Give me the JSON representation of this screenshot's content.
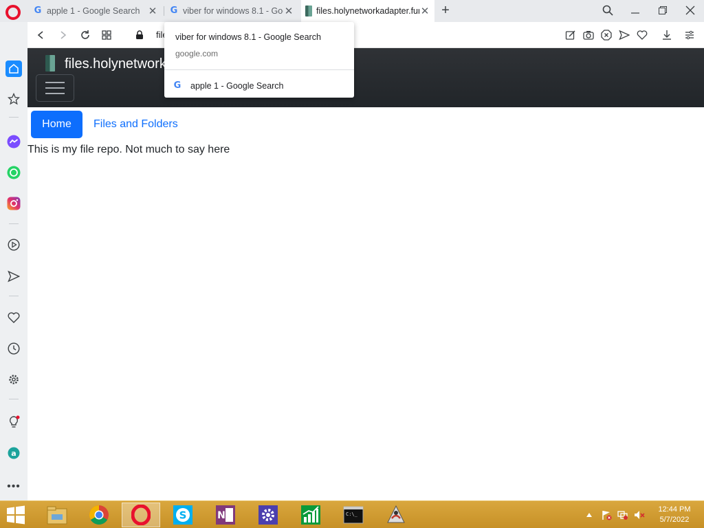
{
  "browser": {
    "tabs": [
      {
        "title": "apple 1 - Google Search",
        "active": false
      },
      {
        "title": "viber for windows 8.1 - Google Search",
        "active": false
      },
      {
        "title": "files.holynetworkadapter.fun",
        "active": true
      }
    ],
    "address_text": "file",
    "accent_color": "#e8112d"
  },
  "tooltip": {
    "title": "viber for windows 8.1 - Google Search",
    "domain": "google.com",
    "recent_item": "apple 1 - Google Search"
  },
  "page": {
    "brand": "files.holynetwork",
    "nav": {
      "home_label": "Home",
      "files_label": "Files and Folders"
    },
    "body_text": "This is my file repo. Not much to say here",
    "colors": {
      "primary": "#0d6efd",
      "navbar": "#212529"
    }
  },
  "taskbar": {
    "apps": [
      "file-explorer",
      "chrome",
      "opera",
      "skype",
      "onenote",
      "settings",
      "stock-chart",
      "command-prompt",
      "java-app"
    ],
    "time": "12:44 PM",
    "date": "5/7/2022"
  }
}
